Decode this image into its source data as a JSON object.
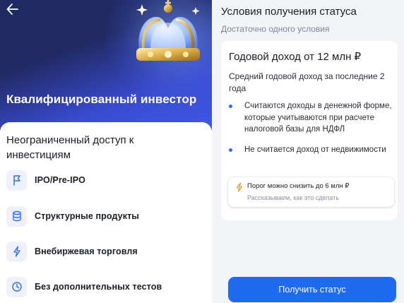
{
  "left_screen": {
    "hero_title": "Квалифицированный инвестор",
    "sheet_title": "Неограниченный доступ к инвестициям",
    "features": [
      {
        "label": "IPO/Pre-IPO",
        "icon": "flag-icon"
      },
      {
        "label": "Структурные продукты",
        "icon": "database-icon"
      },
      {
        "label": "Внебиржевая торговля",
        "icon": "lightning-icon"
      },
      {
        "label": "Без дополнительных тестов",
        "icon": "clock-icon"
      }
    ],
    "icons": {
      "back": "back-arrow-icon",
      "hero": "crown-icon"
    }
  },
  "right_screen": {
    "title": "Условия получения статуса",
    "subtitle": "Достаточно одного условия",
    "card": {
      "title": "Годовой доход от 12 млн ₽",
      "description": "Средний годовой доход за последние 2 года",
      "bullets": [
        "Считаются доходы в денежной форме, которые учитываются при расчете налоговой базы для НДФЛ",
        "Не считается доход от недвижимости"
      ],
      "hint": {
        "title": "Порог можно снизить до 6 млн ₽",
        "subtitle": "Рассказываем, как это сделать",
        "icon": "lightning-icon"
      }
    },
    "button_label": "Получить статус"
  },
  "colors": {
    "accent": "#1f6bf0",
    "hero_dark": "#1f2a63",
    "hero_light": "#3f58e8",
    "bullet": "#2b6ee6",
    "hint_icon": "#e89a1c"
  }
}
